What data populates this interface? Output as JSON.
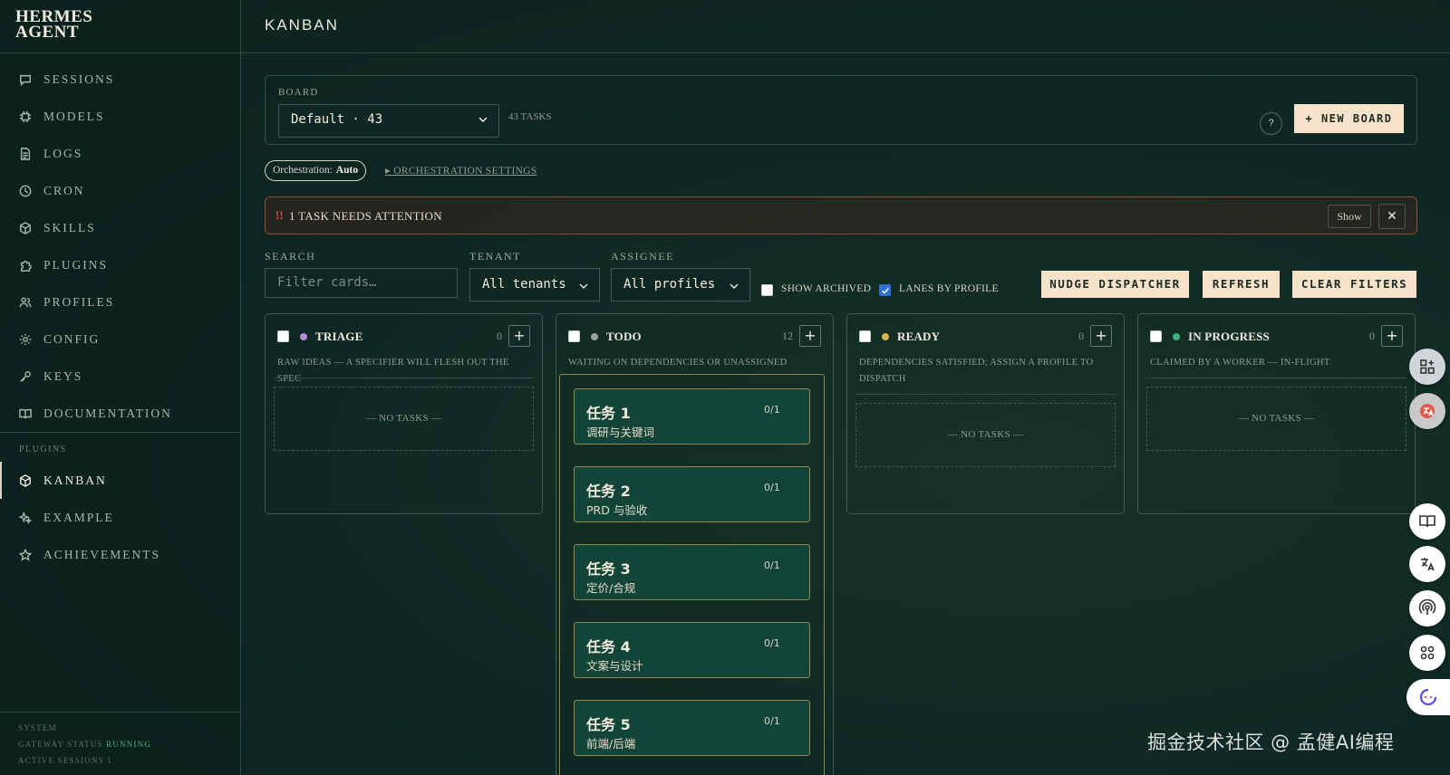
{
  "app": {
    "brand_line1": "HERMES",
    "brand_line2": "AGENT",
    "page_title": "KANBAN"
  },
  "sidebar": {
    "items": [
      {
        "label": "SESSIONS",
        "icon": "chat-icon"
      },
      {
        "label": "MODELS",
        "icon": "chip-icon"
      },
      {
        "label": "LOGS",
        "icon": "document-icon"
      },
      {
        "label": "CRON",
        "icon": "clock-icon"
      },
      {
        "label": "SKILLS",
        "icon": "cube-icon"
      },
      {
        "label": "PLUGINS",
        "icon": "puzzle-icon"
      },
      {
        "label": "PROFILES",
        "icon": "users-icon"
      },
      {
        "label": "CONFIG",
        "icon": "gear-icon"
      },
      {
        "label": "KEYS",
        "icon": "key-icon"
      },
      {
        "label": "DOCUMENTATION",
        "icon": "book-icon"
      }
    ],
    "plugins_label": "PLUGINS",
    "plugin_items": [
      {
        "label": "KANBAN",
        "icon": "box-icon",
        "active": true
      },
      {
        "label": "EXAMPLE",
        "icon": "sparkle-icon",
        "active": false
      },
      {
        "label": "ACHIEVEMENTS",
        "icon": "star-icon",
        "active": false
      }
    ],
    "system": {
      "label": "SYSTEM",
      "gateway_label": "GATEWAY STATUS",
      "gateway_value": "RUNNING",
      "sessions_label": "ACTIVE SESSIONS",
      "sessions_value": "1"
    }
  },
  "board": {
    "label": "BOARD",
    "selected": "Default · 43",
    "task_count": "43 TASKS",
    "help": "?",
    "new_board": "+ NEW BOARD"
  },
  "orchestration": {
    "label": "Orchestration:",
    "value": "Auto",
    "settings_link": "▸ ORCHESTRATION SETTINGS"
  },
  "attention": {
    "icon": "!!",
    "text": "1 TASK NEEDS ATTENTION",
    "show": "Show",
    "close": "✕"
  },
  "filters": {
    "search_label": "SEARCH",
    "search_placeholder": "Filter cards…",
    "tenant_label": "TENANT",
    "tenant_value": "All tenants",
    "assignee_label": "ASSIGNEE",
    "assignee_value": "All profiles",
    "show_archived": "SHOW ARCHIVED",
    "lanes_by_profile": "LANES BY PROFILE",
    "show_archived_checked": false,
    "lanes_by_profile_checked": true,
    "nudge": "NUDGE DISPATCHER",
    "refresh": "REFRESH",
    "clear": "CLEAR FILTERS"
  },
  "lanes": [
    {
      "name": "TRIAGE",
      "count": "0",
      "dot": "#b58ad6",
      "desc": "RAW IDEAS — A SPECIFIER WILL FLESH OUT THE SPEC",
      "empty": "— NO TASKS —"
    },
    {
      "name": "TODO",
      "count": "12",
      "dot": "#9aa09c",
      "desc": "WAITING ON DEPENDENCIES OR UNASSIGNED",
      "empty": ""
    },
    {
      "name": "READY",
      "count": "0",
      "dot": "#d8b84a",
      "desc": "DEPENDENCIES SATISFIED; ASSIGN A PROFILE TO DISPATCH",
      "empty": "— NO TASKS —"
    },
    {
      "name": "IN PROGRESS",
      "count": "0",
      "dot": "#3fb07f",
      "desc": "CLAIMED BY A WORKER — IN-FLIGHT",
      "empty": "— NO TASKS —"
    }
  ],
  "todo_cards": [
    {
      "title": "任务 1",
      "subtitle": "调研与关键词",
      "progress": "0/1"
    },
    {
      "title": "任务 2",
      "subtitle": "PRD 与验收",
      "progress": "0/1"
    },
    {
      "title": "任务 3",
      "subtitle": "定价/合规",
      "progress": "0/1"
    },
    {
      "title": "任务 4",
      "subtitle": "文案与设计",
      "progress": "0/1"
    },
    {
      "title": "任务 5",
      "subtitle": "前端/后端",
      "progress": "0/1"
    }
  ],
  "watermark": "掘金技术社区 @ 孟健AI编程"
}
